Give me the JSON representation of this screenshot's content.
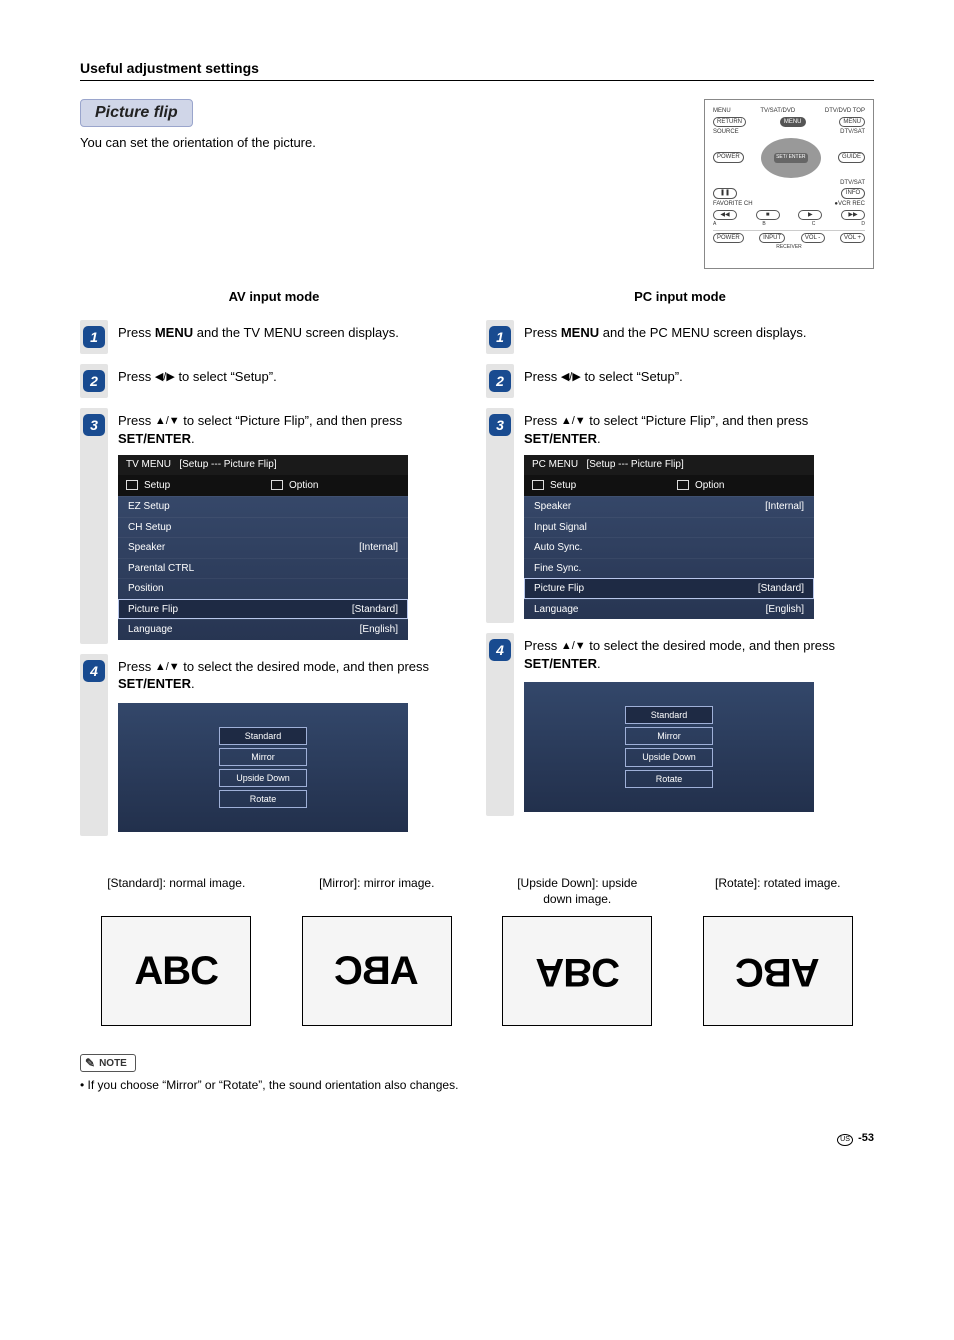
{
  "header": {
    "title": "Useful adjustment settings"
  },
  "section": {
    "title": "Picture flip",
    "intro": "You can set the orientation of the picture."
  },
  "remote": {
    "top": {
      "left": "MENU",
      "center_top": "TV/SAT/DVD",
      "right": "DTV/DVD TOP"
    },
    "row1": {
      "left": "RETURN",
      "center": "MENU",
      "right": "MENU"
    },
    "row2": {
      "left_label": "SOURCE",
      "right_label": "DTV/SAT"
    },
    "row2btn": {
      "left": "POWER",
      "right": "GUIDE"
    },
    "pad_center": "SET/\nENTER",
    "row3_right": "DTV/SAT",
    "row4": {
      "pause": "❚❚",
      "right": "INFO"
    },
    "row5_label": {
      "left": "FAVORITE CH",
      "right": "●VCR REC"
    },
    "row5": {
      "a": "◀◀",
      "a_lbl": "A",
      "b": "■",
      "b_lbl": "B",
      "c": "▶",
      "c_lbl": "C",
      "d": "▶▶",
      "d_lbl": "D"
    },
    "row6": {
      "power": "POWER",
      "input": "INPUT",
      "volm": "VOL -",
      "volp": "VOL +"
    },
    "receiver_label": "RECEIVER"
  },
  "modes": {
    "av_title": "AV input mode",
    "pc_title": "PC input mode"
  },
  "steps_av": {
    "s1": {
      "num": "1",
      "pre": "Press ",
      "bold": "MENU",
      "post": " and the TV MENU screen displays."
    },
    "s2": {
      "num": "2",
      "pre": "Press ",
      "arrows": "◀/▶",
      "post": " to select “Setup”."
    },
    "s3": {
      "num": "3",
      "pre": "Press ",
      "arrows": "▲/▼",
      "post1": " to select “Picture Flip”, and then press ",
      "bold": "SET/ENTER",
      "post2": "."
    },
    "s4": {
      "num": "4",
      "pre": "Press ",
      "arrows": "▲/▼",
      "post1": " to select the desired mode, and then press ",
      "bold": "SET/ENTER",
      "post2": "."
    }
  },
  "steps_pc": {
    "s1": {
      "num": "1",
      "pre": "Press ",
      "bold": "MENU",
      "post": " and the PC MENU screen displays."
    },
    "s2": {
      "num": "2",
      "pre": "Press ",
      "arrows": "◀/▶",
      "post": " to select “Setup”."
    },
    "s3": {
      "num": "3",
      "pre": "Press ",
      "arrows": "▲/▼",
      "post1": " to select “Picture Flip”, and then press ",
      "bold": "SET/ENTER",
      "post2": "."
    },
    "s4": {
      "num": "4",
      "pre": "Press ",
      "arrows": "▲/▼",
      "post1": " to select the desired mode, and then press ",
      "bold": "SET/ENTER",
      "post2": "."
    }
  },
  "menu_av": {
    "title_left": "TV MENU",
    "title_right": "[Setup --- Picture Flip]",
    "tab_setup": "Setup",
    "tab_option": "Option",
    "rows": [
      {
        "label": "EZ Setup",
        "val": ""
      },
      {
        "label": "CH Setup",
        "val": ""
      },
      {
        "label": "Speaker",
        "val": "[Internal]"
      },
      {
        "label": "Parental CTRL",
        "val": ""
      },
      {
        "label": "Position",
        "val": ""
      },
      {
        "label": "Picture Flip",
        "val": "[Standard]",
        "sel": true
      },
      {
        "label": "Language",
        "val": "[English]"
      }
    ]
  },
  "menu_pc": {
    "title_left": "PC MENU",
    "title_right": "[Setup --- Picture Flip]",
    "tab_setup": "Setup",
    "tab_option": "Option",
    "rows": [
      {
        "label": "Speaker",
        "val": "[Internal]"
      },
      {
        "label": "Input Signal",
        "val": ""
      },
      {
        "label": "Auto Sync.",
        "val": ""
      },
      {
        "label": "Fine Sync.",
        "val": ""
      },
      {
        "label": "Picture Flip",
        "val": "[Standard]",
        "sel": true
      },
      {
        "label": "Language",
        "val": "[English]"
      }
    ]
  },
  "options": {
    "items": [
      {
        "label": "Standard",
        "sel": true
      },
      {
        "label": "Mirror"
      },
      {
        "label": "Upside Down"
      },
      {
        "label": "Rotate"
      }
    ]
  },
  "examples": {
    "std": {
      "cap1": "[Standard]: normal image.",
      "cap2": "",
      "text": "ABC"
    },
    "mir": {
      "cap1": "[Mirror]: mirror image.",
      "cap2": "",
      "text": "ABC"
    },
    "ups": {
      "cap1": "[Upside Down]: upside",
      "cap2": "down image.",
      "text": "ABC"
    },
    "rot": {
      "cap1": "[Rotate]: rotated image.",
      "cap2": "",
      "text": "ABC"
    }
  },
  "note": {
    "label": "NOTE",
    "bullet": "If you choose “Mirror” or “Rotate”, the sound orientation also changes."
  },
  "footer": {
    "region": "US",
    "page": "-53"
  }
}
